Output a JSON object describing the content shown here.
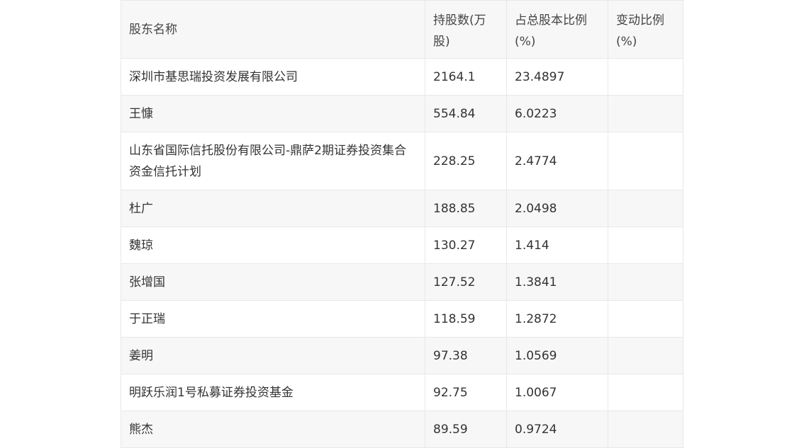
{
  "table": {
    "headers": [
      "股东名称",
      "持股数(万股)",
      "占总股本比例(%)",
      "变动比例(%)"
    ],
    "rows": [
      {
        "name": "深圳市基思瑞投资发展有限公司",
        "shares": "2164.1",
        "ratio": "23.4897",
        "change": ""
      },
      {
        "name": "王慷",
        "shares": "554.84",
        "ratio": "6.0223",
        "change": ""
      },
      {
        "name": "山东省国际信托股份有限公司-鼎萨2期证券投资集合资金信托计划",
        "shares": "228.25",
        "ratio": "2.4774",
        "change": ""
      },
      {
        "name": "杜广",
        "shares": "188.85",
        "ratio": "2.0498",
        "change": ""
      },
      {
        "name": "魏琼",
        "shares": "130.27",
        "ratio": "1.414",
        "change": ""
      },
      {
        "name": "张增国",
        "shares": "127.52",
        "ratio": "1.3841",
        "change": ""
      },
      {
        "name": "于正瑞",
        "shares": "118.59",
        "ratio": "1.2872",
        "change": ""
      },
      {
        "name": "姜明",
        "shares": "97.38",
        "ratio": "1.0569",
        "change": ""
      },
      {
        "name": "明跃乐润1号私募证券投资基金",
        "shares": "92.75",
        "ratio": "1.0067",
        "change": ""
      },
      {
        "name": "熊杰",
        "shares": "89.59",
        "ratio": "0.9724",
        "change": ""
      }
    ]
  }
}
